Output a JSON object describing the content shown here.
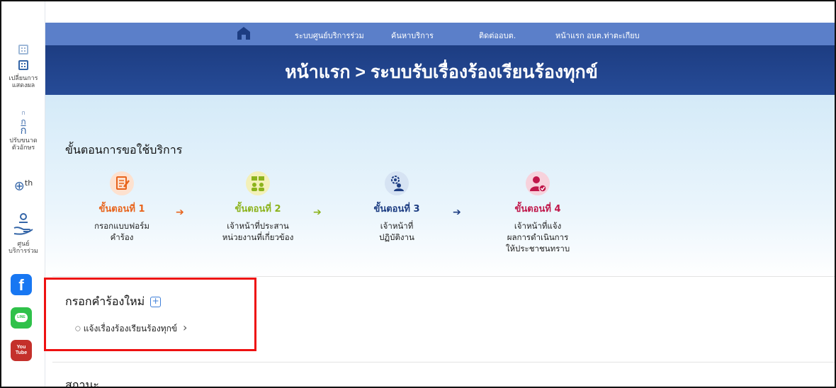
{
  "sidebar": {
    "display_mode_label": "เปลี่ยนการแสดงผล",
    "font_size_label": "ปรับขนาดตัวอักษร",
    "font_letter": "ก",
    "language_code": "th",
    "service_center_label": "ศูนย์บริการร่วม",
    "facebook_glyph": "f",
    "line_glyph": "LINE",
    "youtube_line1": "You",
    "youtube_line2": "Tube"
  },
  "nav": {
    "items": [
      "ระบบศูนย์บริการร่วม",
      "ค้นหาบริการ",
      "ติดต่ออบต.",
      "หน้าแรก อบต.ท่าตะเกียบ"
    ]
  },
  "banner": {
    "title": "หน้าแรก > ระบบรับเรื่องร้องเรียนร้องทุกข์"
  },
  "steps_section": {
    "title": "ขั้นตอนการขอใช้บริการ",
    "arrow_glyph": "➔",
    "steps": [
      {
        "title": "ขั้นตอนที่ 1",
        "desc_line1": "กรอกแบบฟอร์ม",
        "desc_line2": "คำร้อง",
        "desc_line3": "",
        "color": "#e8641c",
        "icon": "form-edit-icon"
      },
      {
        "title": "ขั้นตอนที่ 2",
        "desc_line1": "เจ้าหน้าที่ประสาน",
        "desc_line2": "หน่วยงานที่เกี่ยวข้อง",
        "desc_line3": "",
        "color": "#8cb31c",
        "icon": "coordinate-icon"
      },
      {
        "title": "ขั้นตอนที่ 3",
        "desc_line1": "เจ้าหน้าที่",
        "desc_line2": "ปฏิบัติงาน",
        "desc_line3": "",
        "color": "#1d3d82",
        "icon": "officer-working-icon"
      },
      {
        "title": "ขั้นตอนที่ 4",
        "desc_line1": "เจ้าหน้าที่แจ้ง",
        "desc_line2": "ผลการดำเนินการ",
        "desc_line3": "ให้ประชาชนทราบ",
        "color": "#c0174a",
        "icon": "notify-user-icon"
      }
    ],
    "arrow_colors": [
      "#e8641c",
      "#8cb31c",
      "#1d3d82"
    ]
  },
  "new_request": {
    "title": "กรอกคำร้องใหม่",
    "plus_glyph": "+",
    "link_label": "แจ้งเรื่องร้องเรียนร้องทุกข์",
    "link_chevron": "›"
  },
  "status_section": {
    "title": "สถานะ"
  }
}
